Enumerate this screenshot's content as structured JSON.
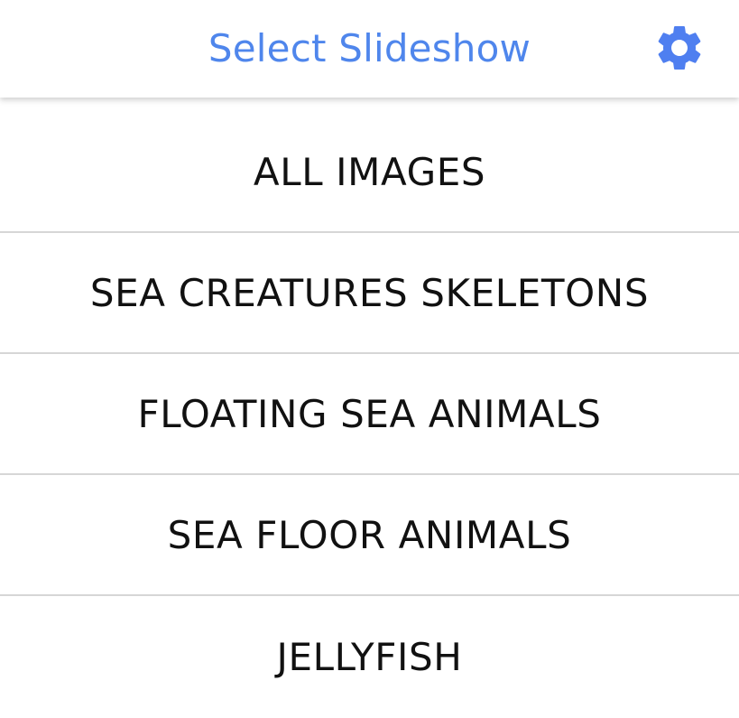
{
  "header": {
    "title": "Select Slideshow",
    "title_color": "#4f86ec",
    "settings_icon": "gear-icon",
    "settings_icon_color": "#4f7ff0"
  },
  "slideshows": {
    "items": [
      {
        "label": "ALL IMAGES"
      },
      {
        "label": "SEA CREATURES SKELETONS"
      },
      {
        "label": "FLOATING SEA ANIMALS"
      },
      {
        "label": "SEA FLOOR ANIMALS"
      },
      {
        "label": "JELLYFISH"
      }
    ]
  }
}
